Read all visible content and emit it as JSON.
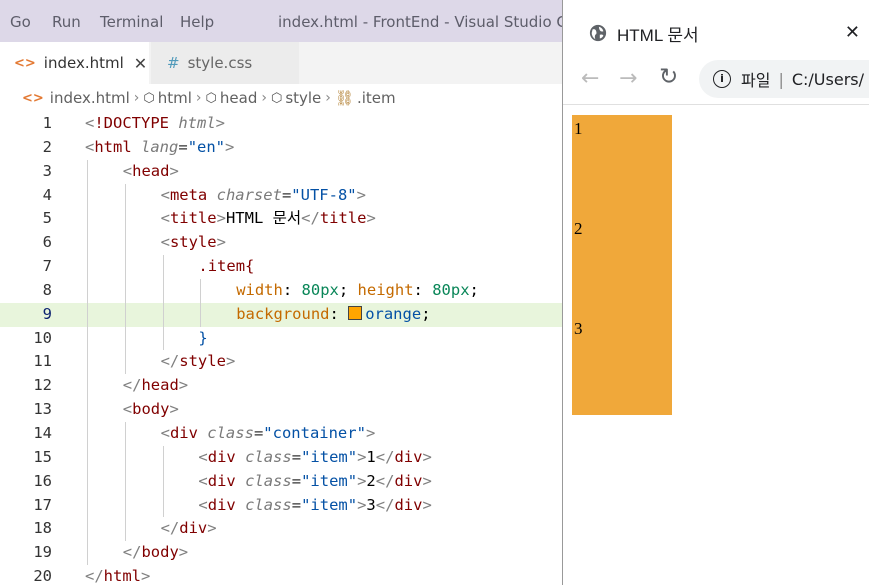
{
  "menubar": {
    "items": [
      "Go",
      "Run",
      "Terminal",
      "Help"
    ],
    "window_title": "index.html - FrontEnd - Visual Studio Code"
  },
  "tabs": [
    {
      "label": "index.html",
      "icon": "<>",
      "active": true,
      "close": "✕"
    },
    {
      "label": "style.css",
      "icon": "#",
      "active": false
    }
  ],
  "breadcrumb": [
    "index.html",
    "html",
    "head",
    "style",
    ".item"
  ],
  "editor": {
    "active_line": 9,
    "line_numbers": [
      "1",
      "2",
      "3",
      "4",
      "5",
      "6",
      "7",
      "8",
      "9",
      "10",
      "11",
      "12",
      "13",
      "14",
      "15",
      "16",
      "17",
      "18",
      "19",
      "20"
    ],
    "swatch_color": "#ffa500"
  },
  "browser": {
    "tab_title": "HTML 문서",
    "url_scheme": "파일",
    "url_path": "C:/Users/",
    "items": [
      "1",
      "2",
      "3"
    ],
    "item_color": "#f0a83a"
  }
}
